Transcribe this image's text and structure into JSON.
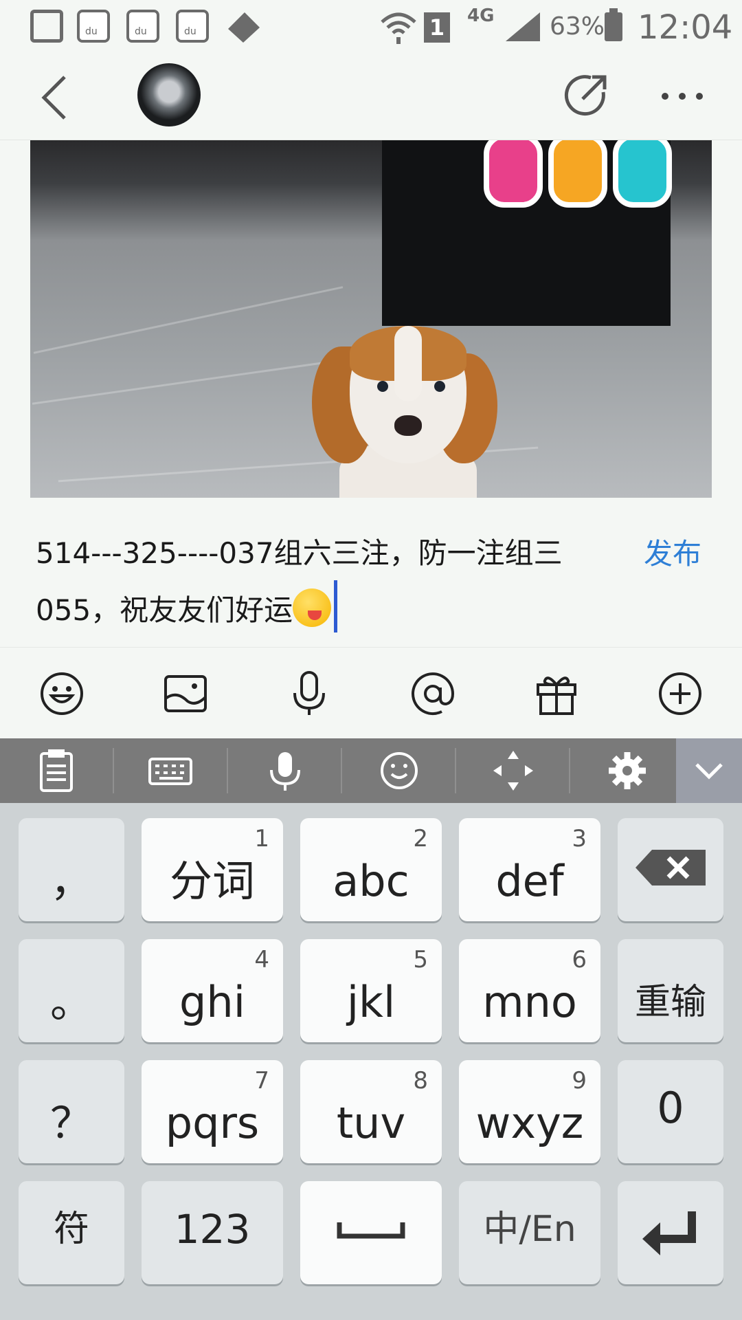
{
  "status_bar": {
    "network": "4G",
    "sim": "1",
    "battery": "63%",
    "time": "12:04",
    "icons": [
      "image-icon",
      "baidu-paw-icon",
      "baidu-paw-icon",
      "baidu-paw-icon",
      "tools-icon",
      "wifi-icon",
      "sim-icon",
      "signal-icon",
      "battery-icon"
    ]
  },
  "header": {
    "back_icon": "chevron-left-icon",
    "share_icon": "share-icon",
    "more_icon": "more-icon"
  },
  "compose": {
    "text": "514---325----037组六三注，防一注组三055，祝友友们好运",
    "publish_label": "发布"
  },
  "toolbar": {
    "icons": [
      "emoji-icon",
      "image-icon",
      "microphone-icon",
      "at-icon",
      "gift-icon",
      "add-icon"
    ]
  },
  "keyboard": {
    "top_icons": [
      "clipboard-icon",
      "keyboard-icon",
      "microphone-icon",
      "emoji-icon",
      "cursor-move-icon",
      "settings-icon",
      "collapse-icon"
    ],
    "rows": [
      [
        {
          "main": "，"
        },
        {
          "main": "分词",
          "num": "1"
        },
        {
          "main": "abc",
          "num": "2"
        },
        {
          "main": "def",
          "num": "3"
        },
        {
          "main": "⌫"
        }
      ],
      [
        {
          "main": "。"
        },
        {
          "main": "ghi",
          "num": "4"
        },
        {
          "main": "jkl",
          "num": "5"
        },
        {
          "main": "mno",
          "num": "6"
        },
        {
          "main": "重输"
        }
      ],
      [
        {
          "main": "？"
        },
        {
          "main": "pqrs",
          "num": "7"
        },
        {
          "main": "tuv",
          "num": "8"
        },
        {
          "main": "wxyz",
          "num": "9"
        },
        {
          "main": "0"
        }
      ],
      [
        {
          "main": "符"
        },
        {
          "main": "123"
        },
        {
          "main": "␣"
        },
        {
          "main": "中/En"
        },
        {
          "main": "↵"
        }
      ]
    ]
  }
}
